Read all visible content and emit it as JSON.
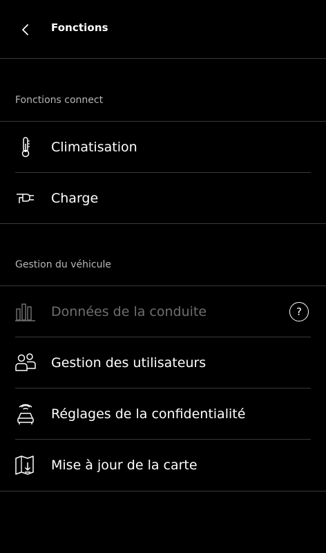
{
  "header": {
    "title": "Fonctions",
    "back_icon": "chevron-left-icon"
  },
  "sections": [
    {
      "title": "Fonctions connect",
      "items": [
        {
          "label": "Climatisation",
          "icon": "thermometer-icon",
          "enabled": true
        },
        {
          "label": "Charge",
          "icon": "plug-icon",
          "enabled": true
        }
      ]
    },
    {
      "title": "Gestion du véhicule",
      "items": [
        {
          "label": "Données de la conduite",
          "icon": "bar-chart-icon",
          "enabled": false,
          "help": "?"
        },
        {
          "label": "Gestion des utilisateurs",
          "icon": "users-icon",
          "enabled": true
        },
        {
          "label": "Réglages de la confidentialité",
          "icon": "connected-car-icon",
          "enabled": true
        },
        {
          "label": "Mise à jour de la carte",
          "icon": "map-download-icon",
          "enabled": true
        }
      ]
    }
  ],
  "colors": {
    "background": "#000000",
    "text": "#ffffff",
    "section_title": "#b8b8b8",
    "disabled": "#6f6f6f",
    "divider": "#3a3a3a"
  }
}
